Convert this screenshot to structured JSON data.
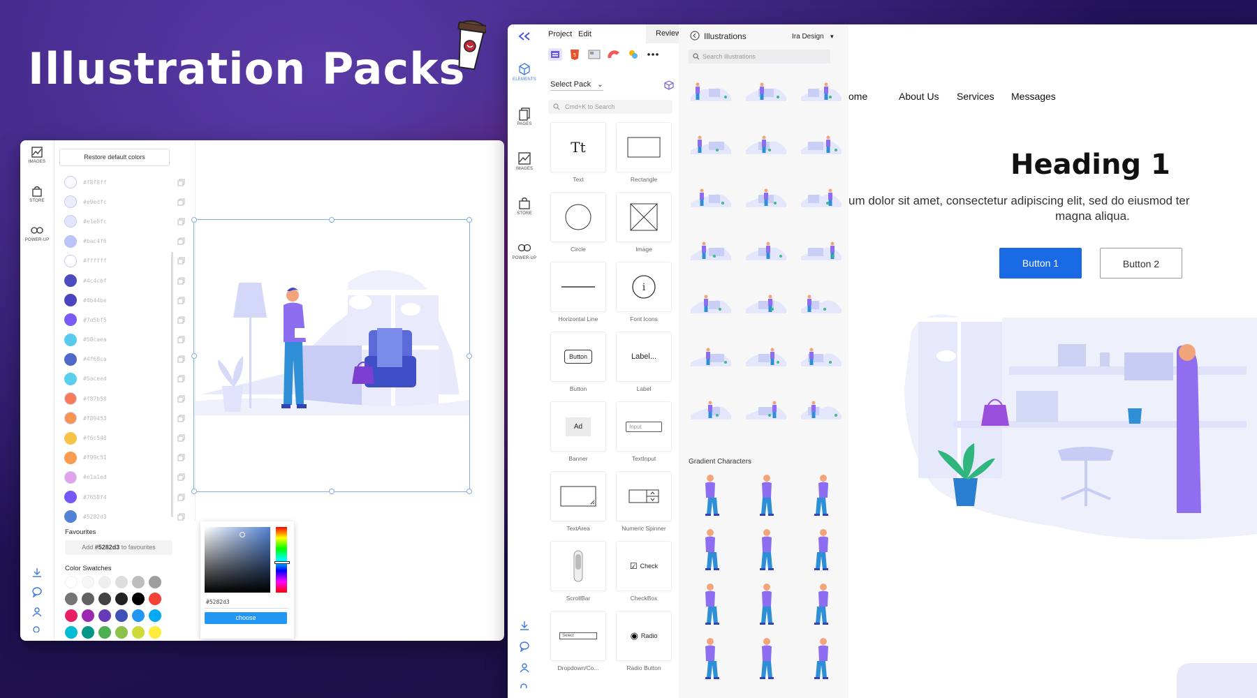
{
  "hero": {
    "title": "Illustration Packs"
  },
  "left_editor": {
    "rail": [
      {
        "label": "IMAGES",
        "icon": "image-icon"
      },
      {
        "label": "STORE",
        "icon": "bag-icon"
      },
      {
        "label": "POWER-UP",
        "icon": "infinity-icon"
      }
    ],
    "restore_label": "Restore default colors",
    "colors": [
      {
        "hex": "#f8f8ff",
        "color": "#f8f8ff"
      },
      {
        "hex": "#e9edfc",
        "color": "#e9edfc"
      },
      {
        "hex": "#e1e6fc",
        "color": "#e1e6fc"
      },
      {
        "hex": "#bac4f6",
        "color": "#bac4f6"
      },
      {
        "hex": "#ffffff",
        "color": "#ffffff"
      },
      {
        "hex": "#4c4cbf",
        "color": "#4c4cbf"
      },
      {
        "hex": "#4b44be",
        "color": "#4b44be"
      },
      {
        "hex": "#7a5bf5",
        "color": "#7a5bf5"
      },
      {
        "hex": "#58caea",
        "color": "#58caea"
      },
      {
        "hex": "#4f68ca",
        "color": "#4f68ca"
      },
      {
        "hex": "#5aceed",
        "color": "#5aceed"
      },
      {
        "hex": "#f87b58",
        "color": "#f87b58"
      },
      {
        "hex": "#f89453",
        "color": "#f89453"
      },
      {
        "hex": "#f6c548",
        "color": "#f6c548"
      },
      {
        "hex": "#f99c51",
        "color": "#f99c51"
      },
      {
        "hex": "#e1a1ed",
        "color": "#e1a1ed"
      },
      {
        "hex": "#7658f4",
        "color": "#7658f4"
      },
      {
        "hex": "#5282d3",
        "color": "#5282d3"
      }
    ],
    "favourites_title": "Favourites",
    "favourites_add_prefix": "Add",
    "favourites_add_hex": "#5282d3",
    "favourites_add_suffix": "to favourites",
    "swatches_title": "Color Swatches",
    "swatches": [
      "#ffffff",
      "#f7f7f7",
      "#eeeeee",
      "#dddddd",
      "#bdbdbd",
      "#9e9e9e",
      "#757575",
      "#616161",
      "#424242",
      "#212121",
      "#000000",
      "#f44336",
      "#e91e63",
      "#9c27b0",
      "#673ab7",
      "#3f51b5",
      "#2196f3",
      "#03a9f4",
      "#00bcd4",
      "#009688",
      "#4caf50",
      "#8bc34a",
      "#cddc39",
      "#ffeb3b"
    ],
    "picker_hex": "#5282d3",
    "picker_choose": "choose"
  },
  "app": {
    "rail": [
      {
        "label": "ELEMENTS",
        "icon": "cube-icon"
      },
      {
        "label": "PAGES",
        "icon": "pages-icon"
      },
      {
        "label": "IMAGES",
        "icon": "image-icon"
      },
      {
        "label": "STORE",
        "icon": "bag-icon"
      },
      {
        "label": "POWER-UP",
        "icon": "infinity-icon"
      }
    ],
    "menu": {
      "project": "Project",
      "edit": "Edit",
      "review": "Review"
    },
    "select_pack": "Select Pack",
    "search_placeholder": "Cmd+K to Search",
    "elements": [
      {
        "label": "Text",
        "glyph": "Tt"
      },
      {
        "label": "Rectangle",
        "glyph": ""
      },
      {
        "label": "Circle",
        "glyph": ""
      },
      {
        "label": "Image",
        "glyph": ""
      },
      {
        "label": "Horizontal Line",
        "glyph": ""
      },
      {
        "label": "Font Icons",
        "glyph": "i"
      },
      {
        "label": "Button",
        "glyph": "Button"
      },
      {
        "label": "Label",
        "glyph": "Label..."
      },
      {
        "label": "Banner",
        "glyph": "Ad"
      },
      {
        "label": "TextInput",
        "glyph": "Input"
      },
      {
        "label": "TextArea",
        "glyph": ""
      },
      {
        "label": "Numeric Spinner",
        "glyph": ""
      },
      {
        "label": "ScrollBar",
        "glyph": ""
      },
      {
        "label": "CheckBox",
        "glyph": "Check"
      },
      {
        "label": "Dropdown/Co...",
        "glyph": "Select"
      },
      {
        "label": "Radio Button",
        "glyph": "Radio"
      }
    ],
    "illustrations": {
      "title": "Illustrations",
      "pack_name": "Ira Design",
      "search_placeholder": "Search illustrations",
      "gradient_title": "Gradient Characters"
    },
    "preview": {
      "nav": [
        "ome",
        "About Us",
        "Services",
        "Messages"
      ],
      "heading": "Heading 1",
      "lorem_line1": "um dolor sit amet, consectetur adipiscing elit, sed do eiusmod ter",
      "lorem_line2": "magna aliqua.",
      "button1": "Button 1",
      "button2": "Button 2"
    }
  },
  "accent_color": "#5282d3",
  "primary_button_color": "#1a6ae6"
}
